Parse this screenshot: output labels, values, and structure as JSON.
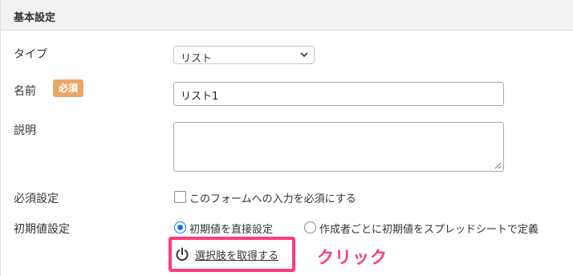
{
  "section": {
    "title": "基本設定"
  },
  "fields": {
    "type": {
      "label": "タイプ",
      "selected": "リスト"
    },
    "name": {
      "label": "名前",
      "required_badge": "必須",
      "value": "リスト1"
    },
    "description": {
      "label": "説明",
      "value": ""
    },
    "required_setting": {
      "label": "必須設定",
      "checkbox_label": "このフォームへの入力を必須にする",
      "checked": false
    },
    "initial_value": {
      "label": "初期値設定",
      "options": [
        {
          "label": "初期値を直接設定",
          "selected": true
        },
        {
          "label": "作成者ごとに初期値をスプレッドシートで定義",
          "selected": false
        }
      ],
      "fetch_button_label": "選択肢を取得する"
    }
  },
  "annotation": {
    "text": "クリック"
  },
  "colors": {
    "accent": "#ff3b7f",
    "badge": "#e8a86a",
    "radio": "#1a73e8"
  }
}
